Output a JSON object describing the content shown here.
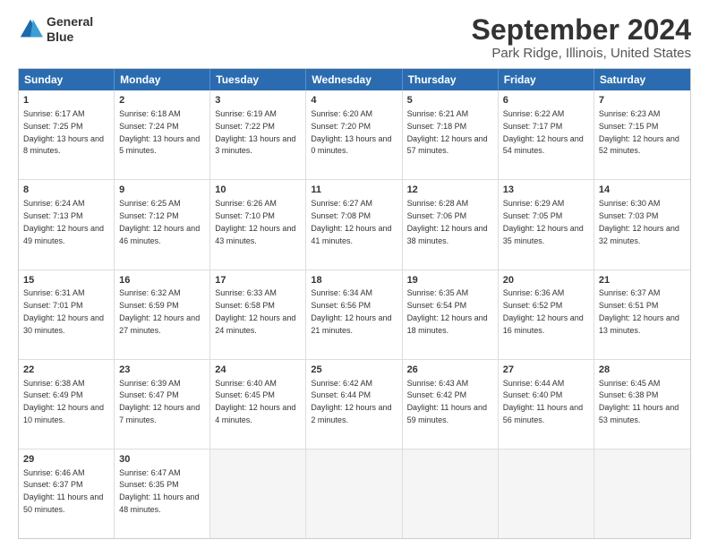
{
  "header": {
    "logo_line1": "General",
    "logo_line2": "Blue",
    "title": "September 2024",
    "subtitle": "Park Ridge, Illinois, United States"
  },
  "days_of_week": [
    "Sunday",
    "Monday",
    "Tuesday",
    "Wednesday",
    "Thursday",
    "Friday",
    "Saturday"
  ],
  "weeks": [
    [
      {
        "day": 1,
        "sunrise": "6:17 AM",
        "sunset": "7:25 PM",
        "daylight": "13 hours and 8 minutes."
      },
      {
        "day": 2,
        "sunrise": "6:18 AM",
        "sunset": "7:24 PM",
        "daylight": "13 hours and 5 minutes."
      },
      {
        "day": 3,
        "sunrise": "6:19 AM",
        "sunset": "7:22 PM",
        "daylight": "13 hours and 3 minutes."
      },
      {
        "day": 4,
        "sunrise": "6:20 AM",
        "sunset": "7:20 PM",
        "daylight": "13 hours and 0 minutes."
      },
      {
        "day": 5,
        "sunrise": "6:21 AM",
        "sunset": "7:18 PM",
        "daylight": "12 hours and 57 minutes."
      },
      {
        "day": 6,
        "sunrise": "6:22 AM",
        "sunset": "7:17 PM",
        "daylight": "12 hours and 54 minutes."
      },
      {
        "day": 7,
        "sunrise": "6:23 AM",
        "sunset": "7:15 PM",
        "daylight": "12 hours and 52 minutes."
      }
    ],
    [
      {
        "day": 8,
        "sunrise": "6:24 AM",
        "sunset": "7:13 PM",
        "daylight": "12 hours and 49 minutes."
      },
      {
        "day": 9,
        "sunrise": "6:25 AM",
        "sunset": "7:12 PM",
        "daylight": "12 hours and 46 minutes."
      },
      {
        "day": 10,
        "sunrise": "6:26 AM",
        "sunset": "7:10 PM",
        "daylight": "12 hours and 43 minutes."
      },
      {
        "day": 11,
        "sunrise": "6:27 AM",
        "sunset": "7:08 PM",
        "daylight": "12 hours and 41 minutes."
      },
      {
        "day": 12,
        "sunrise": "6:28 AM",
        "sunset": "7:06 PM",
        "daylight": "12 hours and 38 minutes."
      },
      {
        "day": 13,
        "sunrise": "6:29 AM",
        "sunset": "7:05 PM",
        "daylight": "12 hours and 35 minutes."
      },
      {
        "day": 14,
        "sunrise": "6:30 AM",
        "sunset": "7:03 PM",
        "daylight": "12 hours and 32 minutes."
      }
    ],
    [
      {
        "day": 15,
        "sunrise": "6:31 AM",
        "sunset": "7:01 PM",
        "daylight": "12 hours and 30 minutes."
      },
      {
        "day": 16,
        "sunrise": "6:32 AM",
        "sunset": "6:59 PM",
        "daylight": "12 hours and 27 minutes."
      },
      {
        "day": 17,
        "sunrise": "6:33 AM",
        "sunset": "6:58 PM",
        "daylight": "12 hours and 24 minutes."
      },
      {
        "day": 18,
        "sunrise": "6:34 AM",
        "sunset": "6:56 PM",
        "daylight": "12 hours and 21 minutes."
      },
      {
        "day": 19,
        "sunrise": "6:35 AM",
        "sunset": "6:54 PM",
        "daylight": "12 hours and 18 minutes."
      },
      {
        "day": 20,
        "sunrise": "6:36 AM",
        "sunset": "6:52 PM",
        "daylight": "12 hours and 16 minutes."
      },
      {
        "day": 21,
        "sunrise": "6:37 AM",
        "sunset": "6:51 PM",
        "daylight": "12 hours and 13 minutes."
      }
    ],
    [
      {
        "day": 22,
        "sunrise": "6:38 AM",
        "sunset": "6:49 PM",
        "daylight": "12 hours and 10 minutes."
      },
      {
        "day": 23,
        "sunrise": "6:39 AM",
        "sunset": "6:47 PM",
        "daylight": "12 hours and 7 minutes."
      },
      {
        "day": 24,
        "sunrise": "6:40 AM",
        "sunset": "6:45 PM",
        "daylight": "12 hours and 4 minutes."
      },
      {
        "day": 25,
        "sunrise": "6:42 AM",
        "sunset": "6:44 PM",
        "daylight": "12 hours and 2 minutes."
      },
      {
        "day": 26,
        "sunrise": "6:43 AM",
        "sunset": "6:42 PM",
        "daylight": "11 hours and 59 minutes."
      },
      {
        "day": 27,
        "sunrise": "6:44 AM",
        "sunset": "6:40 PM",
        "daylight": "11 hours and 56 minutes."
      },
      {
        "day": 28,
        "sunrise": "6:45 AM",
        "sunset": "6:38 PM",
        "daylight": "11 hours and 53 minutes."
      }
    ],
    [
      {
        "day": 29,
        "sunrise": "6:46 AM",
        "sunset": "6:37 PM",
        "daylight": "11 hours and 50 minutes."
      },
      {
        "day": 30,
        "sunrise": "6:47 AM",
        "sunset": "6:35 PM",
        "daylight": "11 hours and 48 minutes."
      },
      {
        "day": null
      },
      {
        "day": null
      },
      {
        "day": null
      },
      {
        "day": null
      },
      {
        "day": null
      }
    ]
  ]
}
